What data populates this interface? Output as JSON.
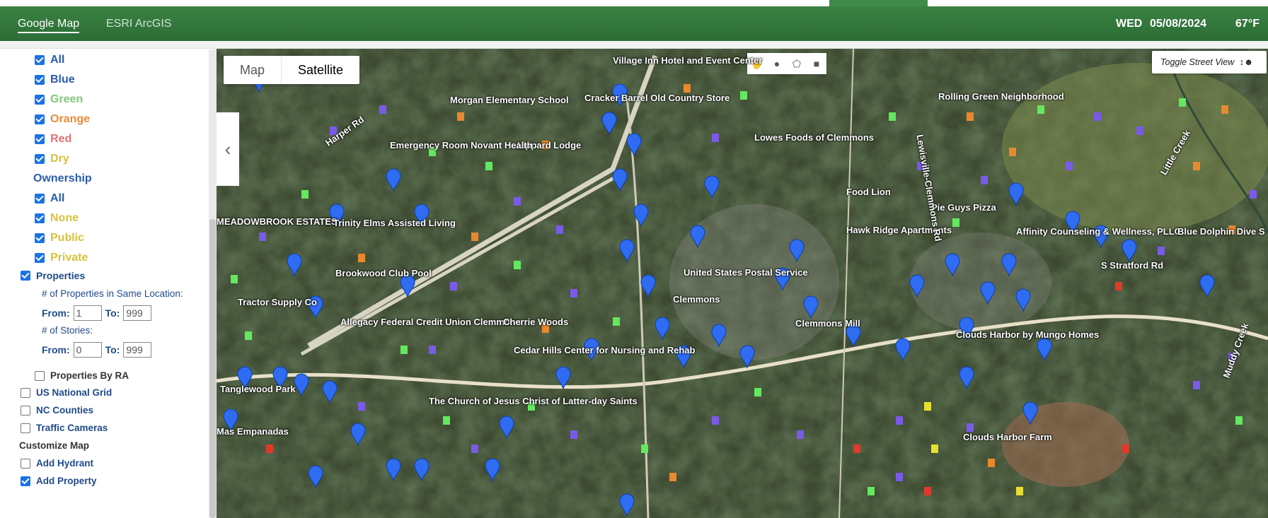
{
  "header": {
    "nav": [
      {
        "label": "Google Map",
        "active": true
      },
      {
        "label": "ESRI ArcGIS",
        "active": false
      }
    ],
    "day": "WED",
    "date": "05/08/2024",
    "temp": "67°F",
    "accent_color": "#2e7d32"
  },
  "sidebar": {
    "flow_items": [
      {
        "label": "All",
        "checked": true,
        "color": "#2a5caa"
      },
      {
        "label": "Blue",
        "checked": true,
        "color": "#2a5caa"
      },
      {
        "label": "Green",
        "checked": true,
        "color": "#7ec77c"
      },
      {
        "label": "Orange",
        "checked": true,
        "color": "#e98a3a"
      },
      {
        "label": "Red",
        "checked": true,
        "color": "#e47373"
      },
      {
        "label": "Dry",
        "checked": true,
        "color": "#d8c23c"
      }
    ],
    "ownership_title": "Ownership",
    "ownership_items": [
      {
        "label": "All",
        "checked": true
      },
      {
        "label": "None",
        "checked": true
      },
      {
        "label": "Public",
        "checked": true
      },
      {
        "label": "Private",
        "checked": true
      }
    ],
    "properties": {
      "label": "Properties",
      "checked": true,
      "same_location_label": "# of Properties in Same Location:",
      "same_location_from": "1",
      "same_location_to": "999",
      "stories_label": "# of Stories:",
      "stories_from": "0",
      "stories_to": "999",
      "from_label": "From:",
      "to_label": "To:"
    },
    "properties_by_ra": {
      "label": "Properties By RA",
      "checked": false
    },
    "layers": [
      {
        "label": "US National Grid",
        "checked": false
      },
      {
        "label": "NC Counties",
        "checked": false
      },
      {
        "label": "Traffic Cameras",
        "checked": false
      }
    ],
    "customize_title": "Customize Map",
    "customize_items": [
      {
        "label": "Add Hydrant",
        "checked": false
      },
      {
        "label": "Add Property",
        "checked": true
      }
    ]
  },
  "map": {
    "type_buttons": [
      {
        "label": "Map",
        "active": false
      },
      {
        "label": "Satellite",
        "active": true
      }
    ],
    "collapse_icon": "chevron-left-icon",
    "draw_tools": [
      "hand-icon",
      "circle-icon",
      "polygon-icon",
      "rectangle-icon"
    ],
    "street_view_label": "Toggle Street View",
    "labels": [
      {
        "text": "Village Inn Hotel and Event Center"
      },
      {
        "text": "Cracker Barrel Old Country Store"
      },
      {
        "text": "Morgan Elementary School"
      },
      {
        "text": "Lippard Lodge"
      },
      {
        "text": "Emergency Room Novant Health"
      },
      {
        "text": "Lowes Foods of Clemmons"
      },
      {
        "text": "Rolling Green Neighborhood"
      },
      {
        "text": "Food Lion"
      },
      {
        "text": "Pie Guys Pizza"
      },
      {
        "text": "Affinity Counseling & Wellness, PLLC"
      },
      {
        "text": "Blue Dolphin Dive S"
      },
      {
        "text": "Hawk Ridge Apartments"
      },
      {
        "text": "S Stratford Rd"
      },
      {
        "text": "MEADOWBROOK ESTATES"
      },
      {
        "text": "Trinity Elms Assisted Living"
      },
      {
        "text": "Brookwood Club Pool"
      },
      {
        "text": "United States Postal Service"
      },
      {
        "text": "Clemmons"
      },
      {
        "text": "Clemmons Mill"
      },
      {
        "text": "Tractor Supply Co"
      },
      {
        "text": "Allegacy Federal Credit Union Clemmons"
      },
      {
        "text": "Cherrie Woods"
      },
      {
        "text": "Cedar Hills Center for Nursing and Rehab"
      },
      {
        "text": "Clouds Harbor by Mungo Homes"
      },
      {
        "text": "Tanglewood Park"
      },
      {
        "text": "The Church of Jesus Christ of Latter-day Saints"
      },
      {
        "text": "Mas Empanadas"
      },
      {
        "text": "Clouds Harbor Farm"
      },
      {
        "text": "Muddy Creek"
      },
      {
        "text": "Little Creek"
      },
      {
        "text": "Harper Rd"
      },
      {
        "text": "Lewisville-Clemmons Rd"
      }
    ]
  }
}
